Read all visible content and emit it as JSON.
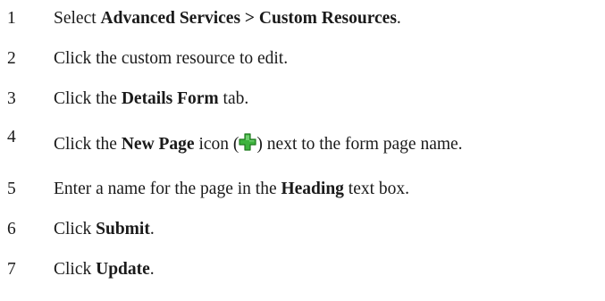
{
  "steps": [
    {
      "number": "1",
      "pre": "Select ",
      "bold": "Advanced Services > Custom Resources",
      "post": "."
    },
    {
      "number": "2",
      "pre": "Click the custom resource to edit.",
      "bold": "",
      "post": ""
    },
    {
      "number": "3",
      "pre": "Click the ",
      "bold": "Details Form",
      "post": " tab."
    },
    {
      "number": "4",
      "pre": "Click the ",
      "bold": "New Page",
      "mid": " icon (",
      "icon": "green-plus-icon",
      "post": ") next to the form page name."
    },
    {
      "number": "5",
      "pre": "Enter a name for the page in the ",
      "bold": "Heading",
      "post": " text box."
    },
    {
      "number": "6",
      "pre": "Click ",
      "bold": "Submit",
      "post": "."
    },
    {
      "number": "7",
      "pre": "Click ",
      "bold": "Update",
      "post": "."
    }
  ],
  "colors": {
    "text": "#1a1a1a",
    "icon_fill": "#3db33d",
    "icon_stroke": "#1f7a1f"
  }
}
